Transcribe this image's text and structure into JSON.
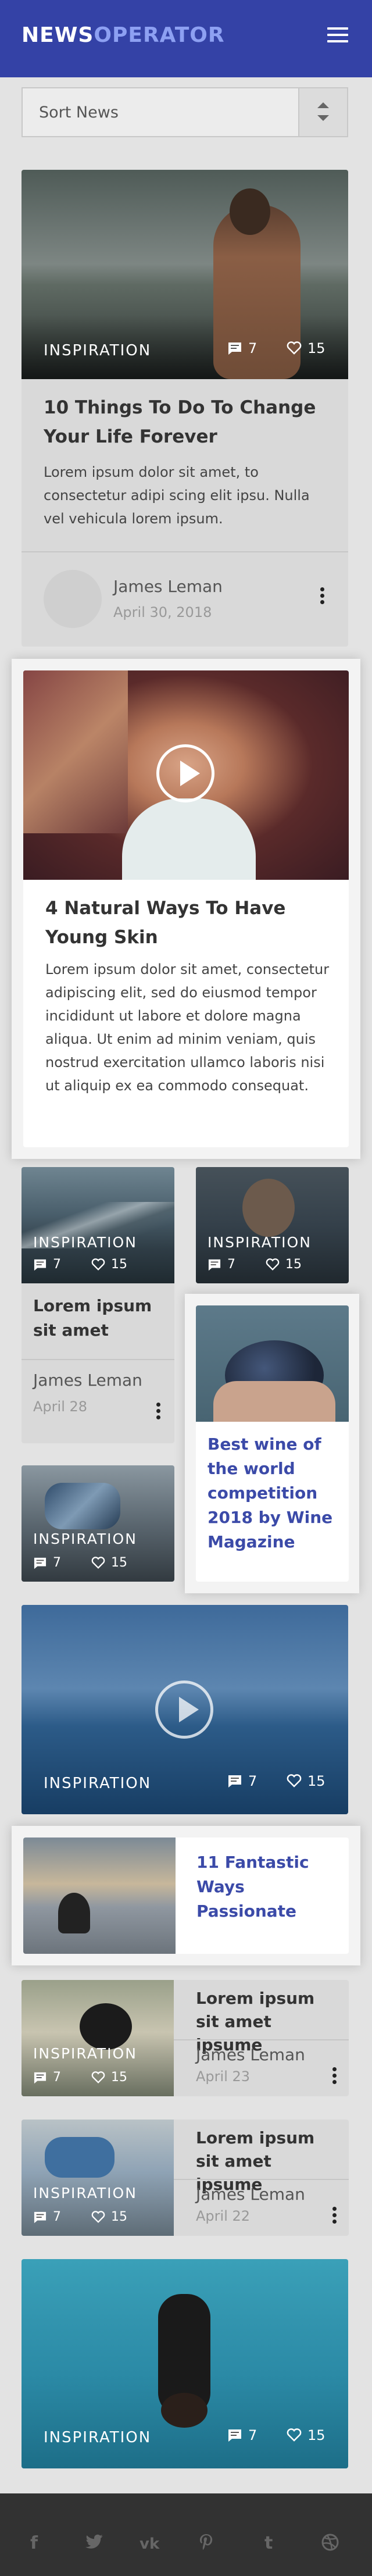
{
  "header": {
    "logo_part1": "NEWS",
    "logo_part2": "OPERATOR"
  },
  "sort": {
    "label": "Sort News"
  },
  "cards": [
    {
      "category": "INSPIRATION",
      "comments": "7",
      "likes": "15",
      "title": "10 Things To Do To Change Your Life Forever",
      "excerpt": "Lorem ipsum dolor sit amet, to consectetur adipi scing elit ipsu. Nulla vel vehicula lorem ipsum.",
      "author": "James Leman",
      "date": "April 30, 2018"
    },
    {
      "title": "4 Natural Ways To Have Young Skin",
      "excerpt": "Lorem ipsum dolor sit amet, consectetur adipiscing elit, sed do eiusmod tempor incididunt ut labore et dolore magna aliqua. Ut enim ad minim veniam, quis nostrud exercitation ullamco laboris nisi ut aliquip ex ea commodo consequat."
    },
    {
      "category": "INSPIRATION",
      "comments": "7",
      "likes": "15",
      "title": "Lorem ipsum sit amet",
      "author": "James Leman",
      "date": "April 28"
    },
    {
      "category": "INSPIRATION",
      "comments": "7",
      "likes": "15"
    },
    {
      "title": "Best wine of the world competition 2018 by Wine Magazine"
    },
    {
      "category": "INSPIRATION",
      "comments": "7",
      "likes": "15"
    },
    {
      "category": "INSPIRATION",
      "comments": "7",
      "likes": "15"
    },
    {
      "title": "11 Fantastic Ways Passionate"
    },
    {
      "category": "INSPIRATION",
      "comments": "7",
      "likes": "15",
      "title": "Lorem ipsum sit amet ipsume",
      "author": "James Leman",
      "date": "April 23"
    },
    {
      "category": "INSPIRATION",
      "comments": "7",
      "likes": "15",
      "title": "Lorem ipsum sit amet ipsume",
      "author": "James Leman",
      "date": "April 22"
    },
    {
      "category": "INSPIRATION",
      "comments": "7",
      "likes": "15"
    }
  ],
  "footer": {
    "icons": [
      "facebook-icon",
      "twitter-icon",
      "vk-icon",
      "pinterest-icon",
      "tumblr-icon",
      "dribbble-icon"
    ]
  },
  "colors": {
    "header": "#3442a6",
    "logo_accent": "#8da0f2",
    "link_blue": "#3b4aa8",
    "footer": "#323232"
  }
}
